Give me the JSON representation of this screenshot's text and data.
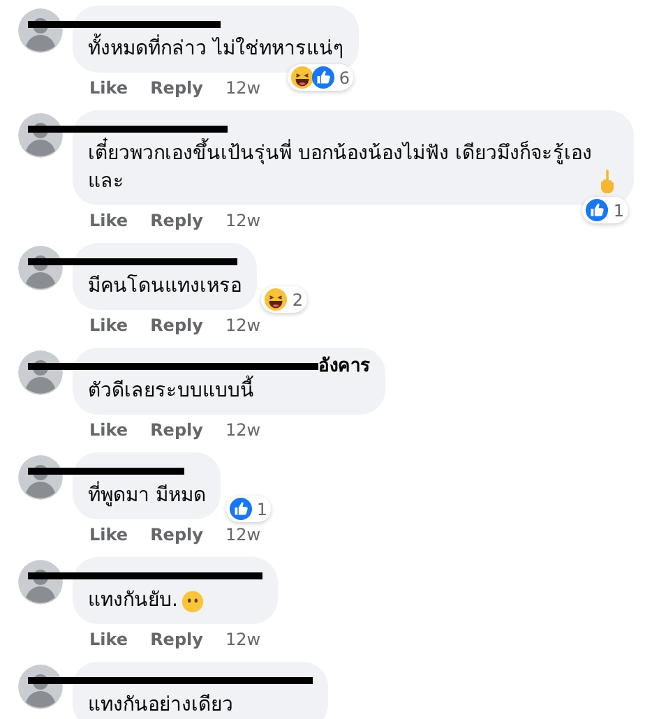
{
  "comments": [
    {
      "text": "ทั้งหมดที่กล่าว ไม่ใช่ทหารแน่ๆ",
      "reactions": {
        "icons": [
          {
            "kind": "haha"
          },
          {
            "kind": "like"
          }
        ],
        "count": "6",
        "below_bubble": true
      },
      "actions": {
        "like": "Like",
        "reply": "Reply",
        "time": "12w"
      }
    },
    {
      "text": "เตี๋ยวพวกเองขึ้นเป้นรุ่นพี่ บอกน้องน้องไม่ฟัง เดียวมึงก็จะรู้เอง และ",
      "emoji": {
        "kind": "finger"
      },
      "reactions": {
        "icons": [
          {
            "kind": "like"
          }
        ],
        "count": "1",
        "below_bubble": true
      },
      "actions": {
        "like": "Like",
        "reply": "Reply",
        "time": "12w"
      }
    },
    {
      "text": "มีคนโดนแทงเหรอ",
      "reactions": {
        "icons": [
          {
            "kind": "haha"
          }
        ],
        "count": "2",
        "below_bubble": false
      },
      "actions": {
        "like": "Like",
        "reply": "Reply",
        "time": "12w"
      }
    },
    {
      "name_tail": "อังคาร",
      "text": "ตัวดีเลยระบบแบบนี้",
      "actions": {
        "like": "Like",
        "reply": "Reply",
        "time": "12w"
      }
    },
    {
      "text": "ที่พูดมา มีหมด",
      "reactions": {
        "icons": [
          {
            "kind": "like"
          }
        ],
        "count": "1",
        "below_bubble": false
      },
      "actions": {
        "like": "Like",
        "reply": "Reply",
        "time": "12w"
      }
    },
    {
      "text": "แทงกันยับ.",
      "emoji": {
        "kind": "face"
      },
      "actions": {
        "like": "Like",
        "reply": "Reply",
        "time": "12w"
      }
    },
    {
      "text": "แทงกันอย่างเดียว"
    }
  ]
}
